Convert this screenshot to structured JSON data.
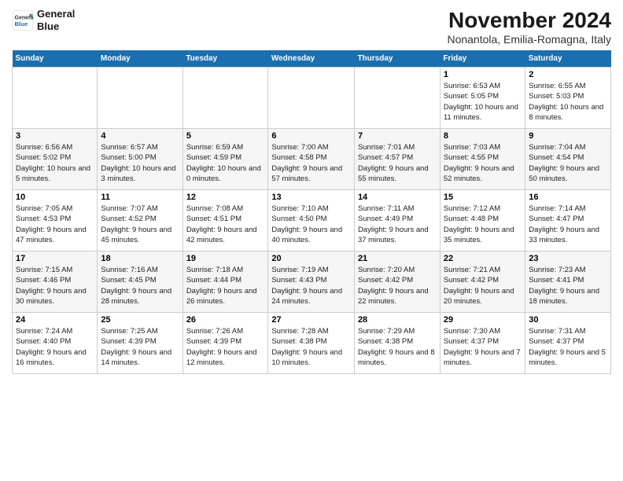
{
  "logo": {
    "line1": "General",
    "line2": "Blue"
  },
  "title": "November 2024",
  "subtitle": "Nonantola, Emilia-Romagna, Italy",
  "weekdays": [
    "Sunday",
    "Monday",
    "Tuesday",
    "Wednesday",
    "Thursday",
    "Friday",
    "Saturday"
  ],
  "weeks": [
    [
      {
        "day": "",
        "sunrise": "",
        "sunset": "",
        "daylight": ""
      },
      {
        "day": "",
        "sunrise": "",
        "sunset": "",
        "daylight": ""
      },
      {
        "day": "",
        "sunrise": "",
        "sunset": "",
        "daylight": ""
      },
      {
        "day": "",
        "sunrise": "",
        "sunset": "",
        "daylight": ""
      },
      {
        "day": "",
        "sunrise": "",
        "sunset": "",
        "daylight": ""
      },
      {
        "day": "1",
        "sunrise": "Sunrise: 6:53 AM",
        "sunset": "Sunset: 5:05 PM",
        "daylight": "Daylight: 10 hours and 11 minutes."
      },
      {
        "day": "2",
        "sunrise": "Sunrise: 6:55 AM",
        "sunset": "Sunset: 5:03 PM",
        "daylight": "Daylight: 10 hours and 8 minutes."
      }
    ],
    [
      {
        "day": "3",
        "sunrise": "Sunrise: 6:56 AM",
        "sunset": "Sunset: 5:02 PM",
        "daylight": "Daylight: 10 hours and 5 minutes."
      },
      {
        "day": "4",
        "sunrise": "Sunrise: 6:57 AM",
        "sunset": "Sunset: 5:00 PM",
        "daylight": "Daylight: 10 hours and 3 minutes."
      },
      {
        "day": "5",
        "sunrise": "Sunrise: 6:59 AM",
        "sunset": "Sunset: 4:59 PM",
        "daylight": "Daylight: 10 hours and 0 minutes."
      },
      {
        "day": "6",
        "sunrise": "Sunrise: 7:00 AM",
        "sunset": "Sunset: 4:58 PM",
        "daylight": "Daylight: 9 hours and 57 minutes."
      },
      {
        "day": "7",
        "sunrise": "Sunrise: 7:01 AM",
        "sunset": "Sunset: 4:57 PM",
        "daylight": "Daylight: 9 hours and 55 minutes."
      },
      {
        "day": "8",
        "sunrise": "Sunrise: 7:03 AM",
        "sunset": "Sunset: 4:55 PM",
        "daylight": "Daylight: 9 hours and 52 minutes."
      },
      {
        "day": "9",
        "sunrise": "Sunrise: 7:04 AM",
        "sunset": "Sunset: 4:54 PM",
        "daylight": "Daylight: 9 hours and 50 minutes."
      }
    ],
    [
      {
        "day": "10",
        "sunrise": "Sunrise: 7:05 AM",
        "sunset": "Sunset: 4:53 PM",
        "daylight": "Daylight: 9 hours and 47 minutes."
      },
      {
        "day": "11",
        "sunrise": "Sunrise: 7:07 AM",
        "sunset": "Sunset: 4:52 PM",
        "daylight": "Daylight: 9 hours and 45 minutes."
      },
      {
        "day": "12",
        "sunrise": "Sunrise: 7:08 AM",
        "sunset": "Sunset: 4:51 PM",
        "daylight": "Daylight: 9 hours and 42 minutes."
      },
      {
        "day": "13",
        "sunrise": "Sunrise: 7:10 AM",
        "sunset": "Sunset: 4:50 PM",
        "daylight": "Daylight: 9 hours and 40 minutes."
      },
      {
        "day": "14",
        "sunrise": "Sunrise: 7:11 AM",
        "sunset": "Sunset: 4:49 PM",
        "daylight": "Daylight: 9 hours and 37 minutes."
      },
      {
        "day": "15",
        "sunrise": "Sunrise: 7:12 AM",
        "sunset": "Sunset: 4:48 PM",
        "daylight": "Daylight: 9 hours and 35 minutes."
      },
      {
        "day": "16",
        "sunrise": "Sunrise: 7:14 AM",
        "sunset": "Sunset: 4:47 PM",
        "daylight": "Daylight: 9 hours and 33 minutes."
      }
    ],
    [
      {
        "day": "17",
        "sunrise": "Sunrise: 7:15 AM",
        "sunset": "Sunset: 4:46 PM",
        "daylight": "Daylight: 9 hours and 30 minutes."
      },
      {
        "day": "18",
        "sunrise": "Sunrise: 7:16 AM",
        "sunset": "Sunset: 4:45 PM",
        "daylight": "Daylight: 9 hours and 28 minutes."
      },
      {
        "day": "19",
        "sunrise": "Sunrise: 7:18 AM",
        "sunset": "Sunset: 4:44 PM",
        "daylight": "Daylight: 9 hours and 26 minutes."
      },
      {
        "day": "20",
        "sunrise": "Sunrise: 7:19 AM",
        "sunset": "Sunset: 4:43 PM",
        "daylight": "Daylight: 9 hours and 24 minutes."
      },
      {
        "day": "21",
        "sunrise": "Sunrise: 7:20 AM",
        "sunset": "Sunset: 4:42 PM",
        "daylight": "Daylight: 9 hours and 22 minutes."
      },
      {
        "day": "22",
        "sunrise": "Sunrise: 7:21 AM",
        "sunset": "Sunset: 4:42 PM",
        "daylight": "Daylight: 9 hours and 20 minutes."
      },
      {
        "day": "23",
        "sunrise": "Sunrise: 7:23 AM",
        "sunset": "Sunset: 4:41 PM",
        "daylight": "Daylight: 9 hours and 18 minutes."
      }
    ],
    [
      {
        "day": "24",
        "sunrise": "Sunrise: 7:24 AM",
        "sunset": "Sunset: 4:40 PM",
        "daylight": "Daylight: 9 hours and 16 minutes."
      },
      {
        "day": "25",
        "sunrise": "Sunrise: 7:25 AM",
        "sunset": "Sunset: 4:39 PM",
        "daylight": "Daylight: 9 hours and 14 minutes."
      },
      {
        "day": "26",
        "sunrise": "Sunrise: 7:26 AM",
        "sunset": "Sunset: 4:39 PM",
        "daylight": "Daylight: 9 hours and 12 minutes."
      },
      {
        "day": "27",
        "sunrise": "Sunrise: 7:28 AM",
        "sunset": "Sunset: 4:38 PM",
        "daylight": "Daylight: 9 hours and 10 minutes."
      },
      {
        "day": "28",
        "sunrise": "Sunrise: 7:29 AM",
        "sunset": "Sunset: 4:38 PM",
        "daylight": "Daylight: 9 hours and 8 minutes."
      },
      {
        "day": "29",
        "sunrise": "Sunrise: 7:30 AM",
        "sunset": "Sunset: 4:37 PM",
        "daylight": "Daylight: 9 hours and 7 minutes."
      },
      {
        "day": "30",
        "sunrise": "Sunrise: 7:31 AM",
        "sunset": "Sunset: 4:37 PM",
        "daylight": "Daylight: 9 hours and 5 minutes."
      }
    ]
  ]
}
